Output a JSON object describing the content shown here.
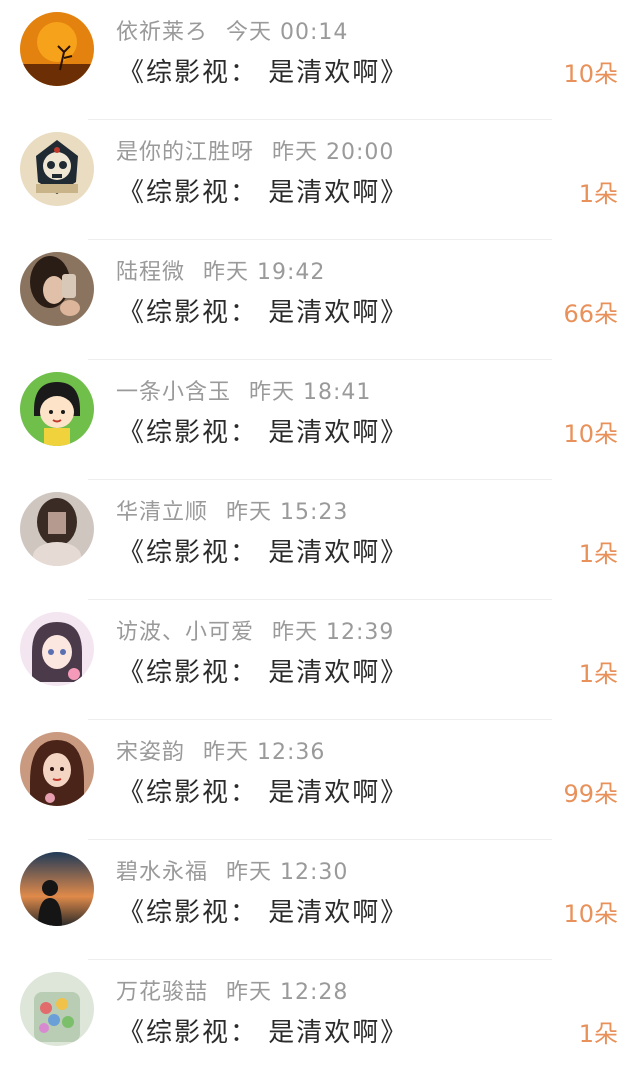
{
  "accent": "#e8915a",
  "items": [
    {
      "name": "依祈莱ろ",
      "time": "今天 00:14",
      "gift": "《综影视： 是清欢啊》",
      "count": "10朵",
      "avatar_icon": "sunset-tree-avatar"
    },
    {
      "name": "是你的江胜呀",
      "time": "昨天 20:00",
      "gift": "《综影视： 是清欢啊》",
      "count": "1朵",
      "avatar_icon": "skull-red-ale-avatar"
    },
    {
      "name": "陆程微",
      "time": "昨天 19:42",
      "gift": "《综影视： 是清欢啊》",
      "count": "66朵",
      "avatar_icon": "girl-selfie-avatar"
    },
    {
      "name": "一条小含玉",
      "time": "昨天 18:41",
      "gift": "《综影视： 是清欢啊》",
      "count": "10朵",
      "avatar_icon": "cartoon-girl-avatar"
    },
    {
      "name": "华清立顺",
      "time": "昨天 15:23",
      "gift": "《综影视： 是清欢啊》",
      "count": "1朵",
      "avatar_icon": "blurred-photo-avatar"
    },
    {
      "name": "访波、小可爱",
      "time": "昨天 12:39",
      "gift": "《综影视： 是清欢啊》",
      "count": "1朵",
      "avatar_icon": "anime-girl-avatar"
    },
    {
      "name": "宋姿韵",
      "time": "昨天 12:36",
      "gift": "《综影视： 是清欢啊》",
      "count": "99朵",
      "avatar_icon": "woman-portrait-avatar"
    },
    {
      "name": "碧水永福",
      "time": "昨天 12:30",
      "gift": "《综影视： 是清欢啊》",
      "count": "10朵",
      "avatar_icon": "silhouette-sunset-avatar"
    },
    {
      "name": "万花骏喆",
      "time": "昨天 12:28",
      "gift": "《综影视： 是清欢啊》",
      "count": "1朵",
      "avatar_icon": "flower-jar-avatar"
    }
  ]
}
